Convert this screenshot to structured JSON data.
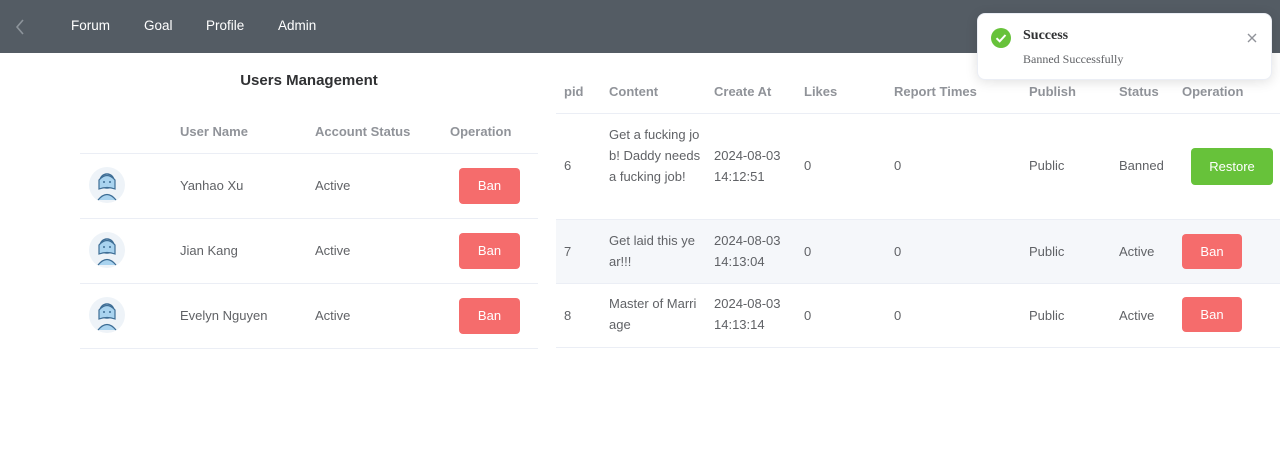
{
  "nav": {
    "back_icon": "chevron-left-icon",
    "items": [
      {
        "label": "Forum"
      },
      {
        "label": "Goal"
      },
      {
        "label": "Profile"
      },
      {
        "label": "Admin"
      }
    ]
  },
  "users": {
    "title": "Users Management",
    "columns": {
      "name": "User Name",
      "status": "Account Status",
      "operation": "Operation"
    },
    "rows": [
      {
        "avatar_icon": "user-avatar-icon",
        "name": "Yanhao Xu",
        "status": "Active",
        "action": "Ban"
      },
      {
        "avatar_icon": "user-avatar-icon",
        "name": "Jian Kang",
        "status": "Active",
        "action": "Ban"
      },
      {
        "avatar_icon": "user-avatar-icon",
        "name": "Evelyn Nguyen",
        "status": "Active",
        "action": "Ban"
      }
    ]
  },
  "posts": {
    "columns": {
      "pid": "pid",
      "content": "Content",
      "create_at": "Create At",
      "likes": "Likes",
      "reports": "Report Times",
      "publish": "Publish",
      "status": "Status",
      "operation": "Operation"
    },
    "rows": [
      {
        "pid": "6",
        "content": "Get a fucking job! Daddy needs a fucking job!",
        "date": "2024-08-03",
        "time": "14:12:51",
        "likes": "0",
        "reports": "0",
        "publish": "Public",
        "status": "Banned",
        "action": "Restore"
      },
      {
        "pid": "7",
        "content": "Get laid this year!!!",
        "date": "2024-08-03",
        "time": "14:13:04",
        "likes": "0",
        "reports": "0",
        "publish": "Public",
        "status": "Active",
        "action": "Ban"
      },
      {
        "pid": "8",
        "content": "Master of Marriage",
        "date": "2024-08-03",
        "time": "14:13:14",
        "likes": "0",
        "reports": "0",
        "publish": "Public",
        "status": "Active",
        "action": "Ban"
      }
    ]
  },
  "toast": {
    "icon": "success-check-icon",
    "title": "Success",
    "message": "Banned Successfully",
    "close_icon": "close-icon"
  },
  "colors": {
    "nav_bg": "#545c64",
    "danger": "#f56c6c",
    "success": "#67c23a",
    "stripe": "#f5f7fa"
  }
}
